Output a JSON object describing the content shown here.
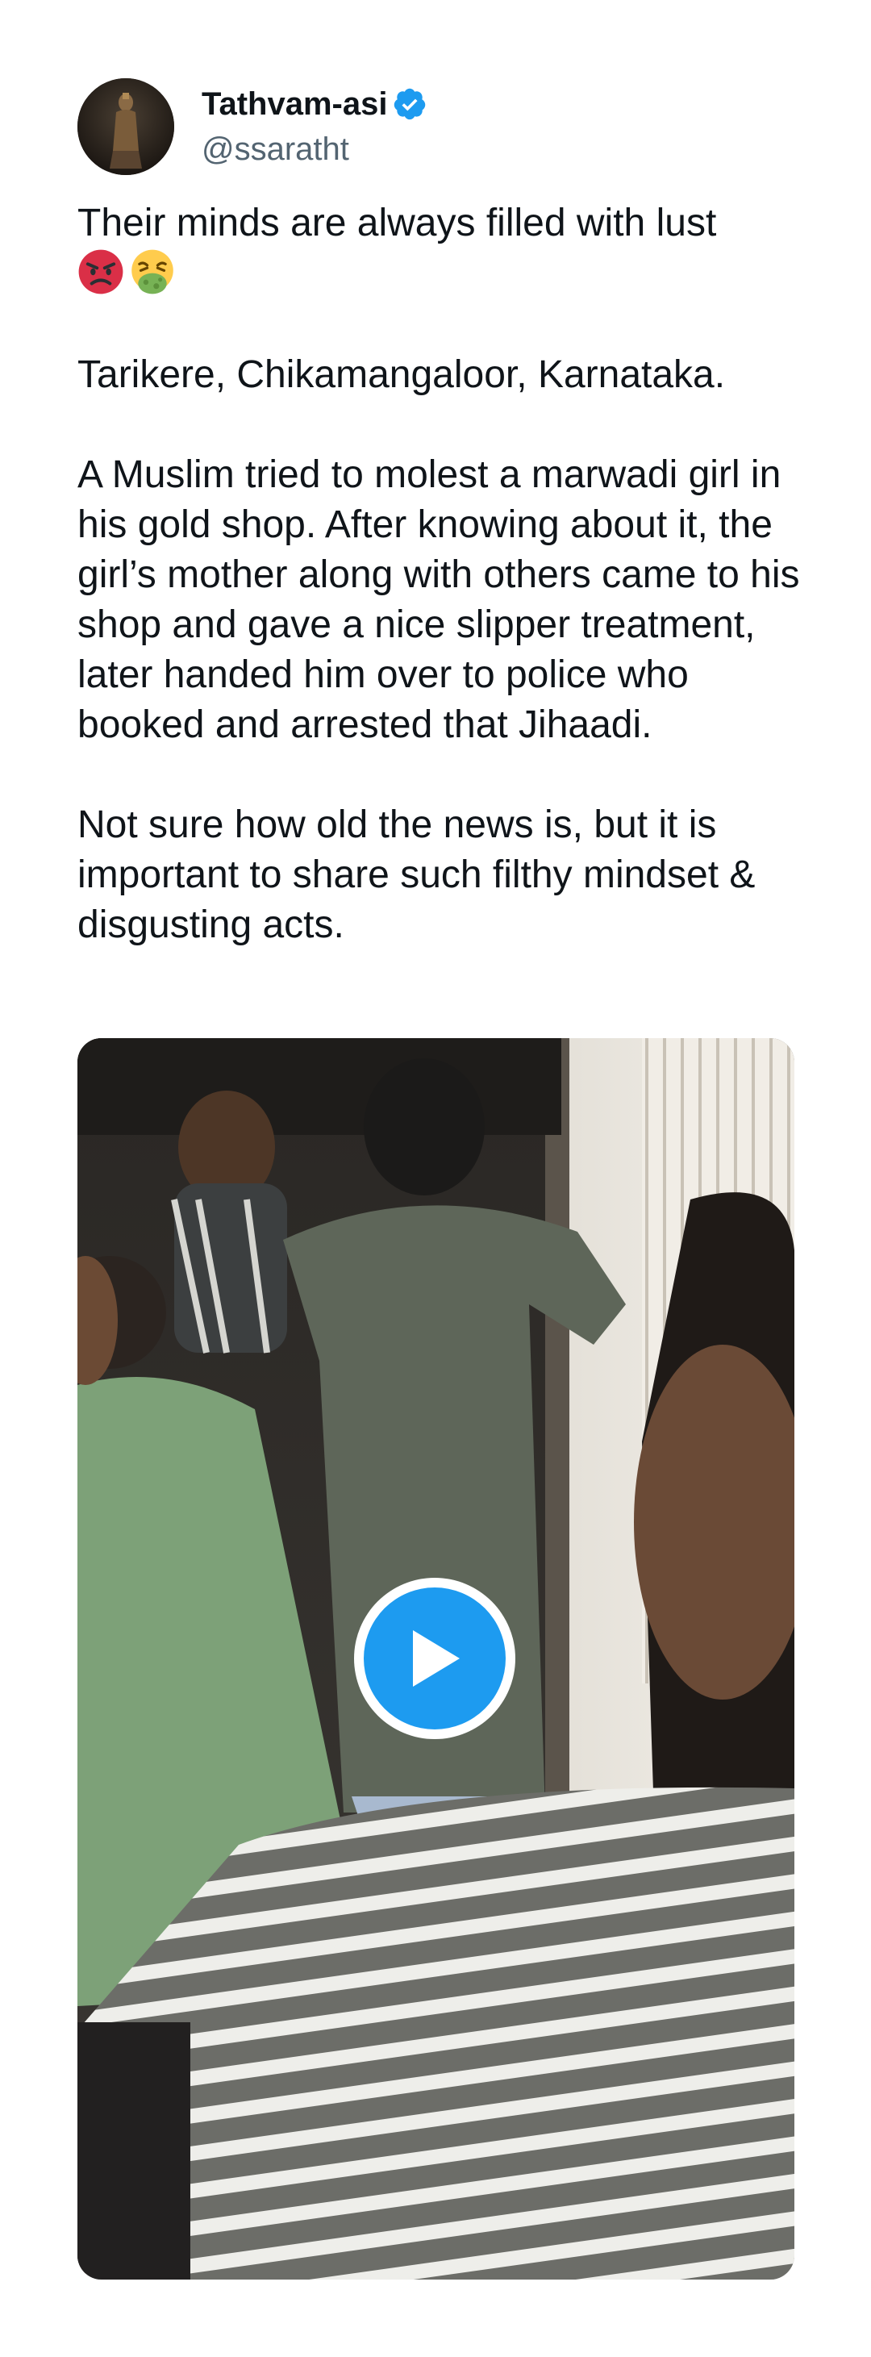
{
  "author": {
    "display_name": "Tathvam-asi",
    "handle": "@ssaratht",
    "verified": true,
    "avatar_icon": "avatar-statue-photo",
    "verified_icon": "verified-badge-icon"
  },
  "tweet": {
    "line1": "Their minds are always filled with lust",
    "emojis": [
      "angry-face-emoji",
      "face-with-symbols-vomit-emoji"
    ],
    "location": "Tarikere, Chikamangaloor, Karnataka.",
    "body": "A Muslim tried to molest a marwadi girl in his gold shop. After knowing about it, the girl’s mother along with others came to his shop and gave a nice slipper treatment, later handed him over to police who booked and arrested that Jihaadi.",
    "closing": "Not sure how old the news is, but it is important to share such filthy mindset & disgusting acts."
  },
  "media": {
    "type": "video",
    "play_icon": "play-icon"
  },
  "colors": {
    "text": "#0f1419",
    "secondary": "#536471",
    "accent": "#1d9bf0"
  }
}
